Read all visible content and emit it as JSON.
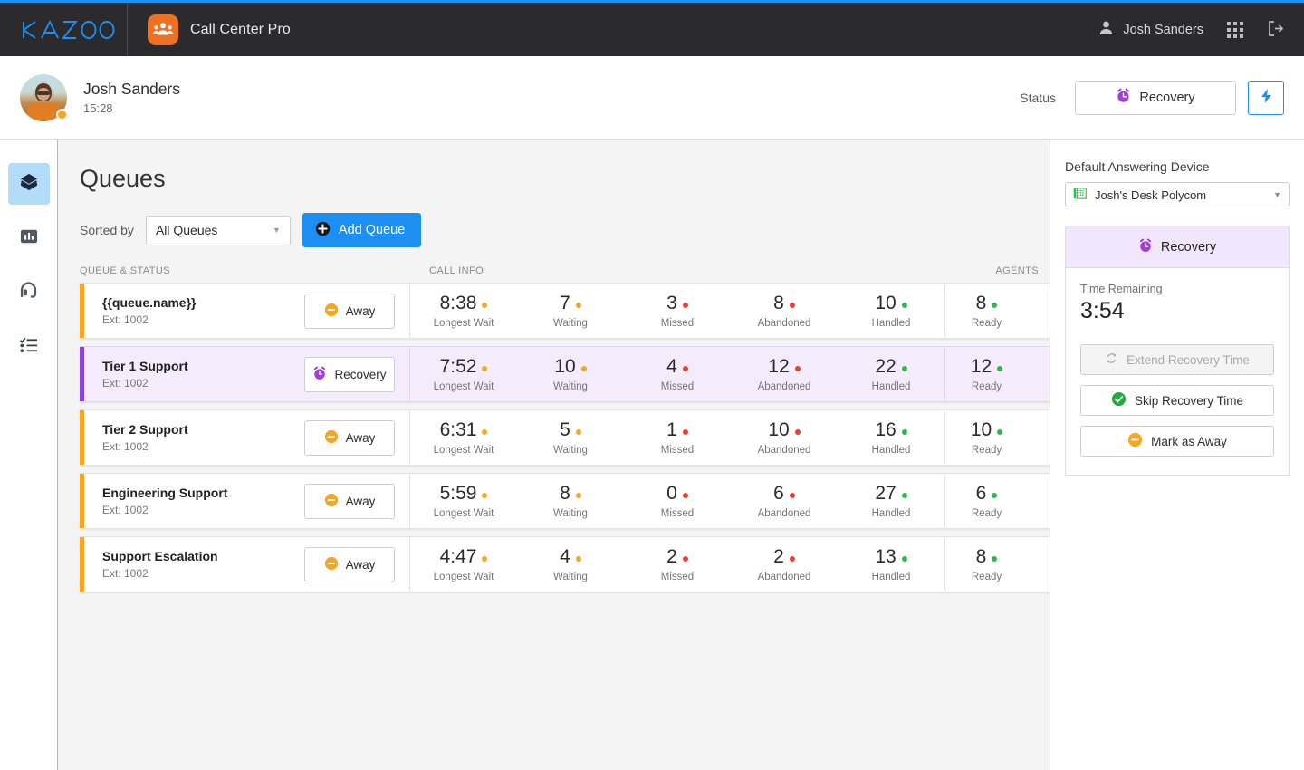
{
  "brand": {
    "logo_text": "KAZOO",
    "accent": "#1d8ff2"
  },
  "appbar": {
    "app_name": "Call Center Pro",
    "user_name": "Josh Sanders",
    "icons": {
      "user": "user-icon",
      "apps": "apps-grid-icon",
      "logout": "logout-icon"
    }
  },
  "statusbar": {
    "user_name": "Josh Sanders",
    "time": "15:28",
    "status_label": "Status",
    "status_value": "Recovery",
    "flash_icon": "lightning-bolt-icon",
    "presence_color": "#f5a623"
  },
  "rail": {
    "items": [
      {
        "name": "queues",
        "icon": "layers-icon",
        "active": true
      },
      {
        "name": "dashboard",
        "icon": "bar-chart-icon",
        "active": false
      },
      {
        "name": "agents",
        "icon": "headset-icon",
        "active": false
      },
      {
        "name": "lists",
        "icon": "checklist-icon",
        "active": false
      }
    ]
  },
  "main": {
    "title": "Queues",
    "sorted_by_label": "Sorted by",
    "sort_value": "All Queues",
    "add_queue_label": "Add Queue",
    "columns": {
      "queue_status": "QUEUE & STATUS",
      "call_info": "CALL INFO",
      "agents": "AGENTS"
    },
    "stat_labels": {
      "longest_wait": "Longest Wait",
      "waiting": "Waiting",
      "missed": "Missed",
      "abandoned": "Abandoned",
      "handled": "Handled",
      "ready": "Ready"
    },
    "stat_colors": {
      "longest_wait": "#f5a623",
      "waiting": "#f5a623",
      "missed": "#f03e2f",
      "abandoned": "#f03e2f",
      "handled": "#2cb84a",
      "ready": "#2cb84a"
    },
    "rows": [
      {
        "name": "{{queue.name}}",
        "ext": "Ext: 1002",
        "status": "Away",
        "status_icon": "away-minus-icon",
        "active": false,
        "longest_wait": "8:38",
        "waiting": "7",
        "missed": "3",
        "abandoned": "8",
        "handled": "10",
        "ready": "8"
      },
      {
        "name": "Tier 1 Support",
        "ext": "Ext: 1002",
        "status": "Recovery",
        "status_icon": "alarm-clock-icon",
        "active": true,
        "longest_wait": "7:52",
        "waiting": "10",
        "missed": "4",
        "abandoned": "12",
        "handled": "22",
        "ready": "12"
      },
      {
        "name": "Tier 2 Support",
        "ext": "Ext: 1002",
        "status": "Away",
        "status_icon": "away-minus-icon",
        "active": false,
        "longest_wait": "6:31",
        "waiting": "5",
        "missed": "1",
        "abandoned": "10",
        "handled": "16",
        "ready": "10"
      },
      {
        "name": "Engineering Support",
        "ext": "Ext: 1002",
        "status": "Away",
        "status_icon": "away-minus-icon",
        "active": false,
        "longest_wait": "5:59",
        "waiting": "8",
        "missed": "0",
        "abandoned": "6",
        "handled": "27",
        "ready": "6"
      },
      {
        "name": "Support Escalation",
        "ext": "Ext: 1002",
        "status": "Away",
        "status_icon": "away-minus-icon",
        "active": false,
        "longest_wait": "4:47",
        "waiting": "4",
        "missed": "2",
        "abandoned": "2",
        "handled": "13",
        "ready": "8"
      }
    ]
  },
  "rightpanel": {
    "device_label": "Default Answering Device",
    "device_value": "Josh's Desk Polycom",
    "device_icon": "desk-phone-icon",
    "recovery_title": "Recovery",
    "time_remaining_label": "Time Remaining",
    "time_remaining_value": "3:54",
    "extend_label": "Extend Recovery Time",
    "extend_icon": "refresh-icon",
    "skip_label": "Skip Recovery Time",
    "skip_icon": "check-circle-icon",
    "mark_away_label": "Mark as Away",
    "mark_away_icon": "away-minus-icon"
  }
}
